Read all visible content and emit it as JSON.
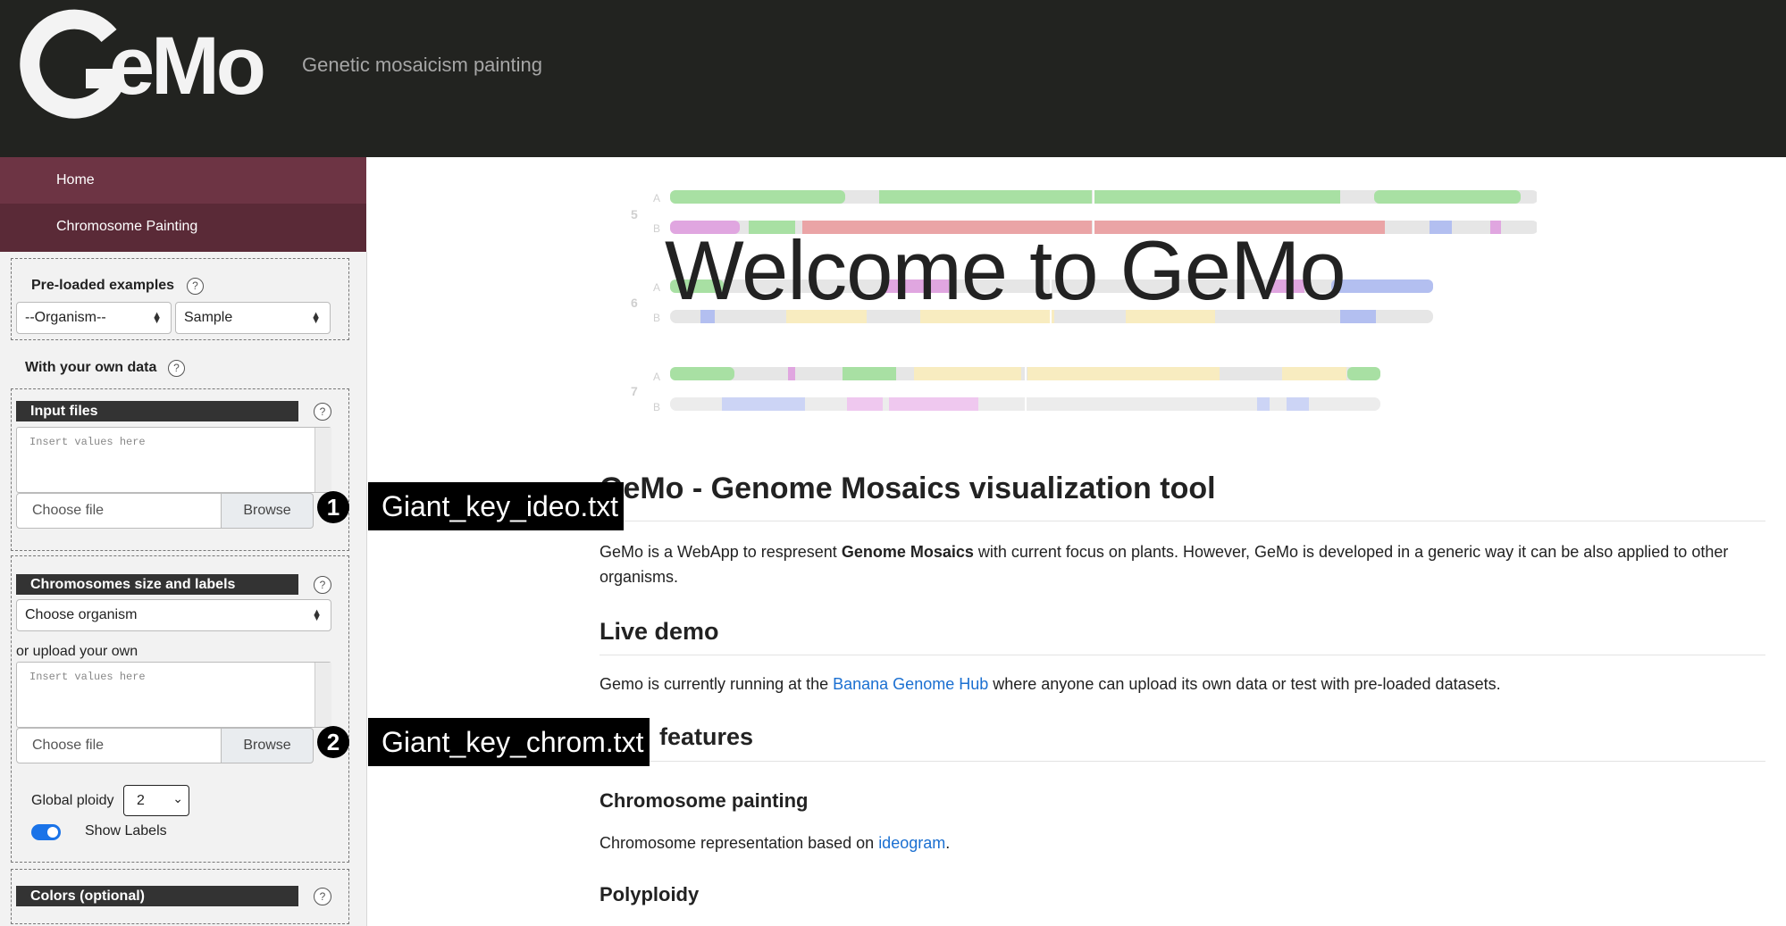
{
  "header": {
    "logo_text": "GeMo",
    "subtitle": "Genetic mosaicism painting"
  },
  "nav": {
    "home": "Home",
    "chromosome_painting": "Chromosome Painting"
  },
  "sidebar": {
    "preloaded": {
      "label": "Pre-loaded examples",
      "organism_select": "--Organism--",
      "sample_select": "Sample"
    },
    "own_data_label": "With your own data",
    "input_files": {
      "label": "Input files",
      "textarea_placeholder": "Insert values here",
      "file_placeholder": "Choose file",
      "browse": "Browse"
    },
    "chromosomes": {
      "label": "Chromosomes size and labels",
      "organism_select": "Choose organism",
      "upload_label": "or upload your own",
      "textarea_placeholder": "Insert values here",
      "file_placeholder": "Choose file",
      "browse": "Browse"
    },
    "ploidy": {
      "label": "Global ploidy",
      "value": "2"
    },
    "show_labels": {
      "label": "Show Labels",
      "on": true
    },
    "colors": {
      "label": "Colors (optional)"
    },
    "help_symbol": "?"
  },
  "annotations": [
    {
      "number": "1",
      "text": "Giant_key_ideo.txt"
    },
    {
      "number": "2",
      "text": "Giant_key_chrom.txt"
    }
  ],
  "ideogram": {
    "chromosomes": [
      {
        "number": "5",
        "tracks": [
          "A",
          "B"
        ]
      },
      {
        "number": "6",
        "tracks": [
          "A",
          "B"
        ]
      },
      {
        "number": "7",
        "tracks": [
          "A",
          "B"
        ]
      }
    ],
    "colors": {
      "green": "#a8e0a3",
      "red": "#eaa4a6",
      "pink": "#e0a6e0",
      "blue": "#b3bff0",
      "yellow": "#f8ecc0",
      "grey": "#e6e6e6"
    }
  },
  "main": {
    "welcome": "Welcome to GeMo",
    "title": "GeMo - Genome Mosaics visualization tool",
    "intro_pre": "GeMo is a WebApp to respresent ",
    "intro_bold": "Genome Mosaics",
    "intro_post": " with current focus on plants. However, GeMo is developed in a generic way it can be also applied to other organisms.",
    "live_demo_heading": "Live demo",
    "live_demo_pre": "Gemo is currently running at the ",
    "live_demo_link": "Banana Genome Hub",
    "live_demo_post": " where anyone can upload its own data or test with pre-loaded datasets.",
    "features_heading": "features",
    "chrom_painting_heading": "Chromosome painting",
    "chrom_painting_pre": "Chromosome representation based on ",
    "chrom_painting_link": "ideogram",
    "chrom_painting_post": ".",
    "polyploidy_heading": "Polyploidy"
  },
  "colors": {
    "header_bg": "#222320",
    "nav_home_bg": "#6d3444",
    "nav_paint_bg": "#5a2a37",
    "link": "#1a6fd1",
    "toggle": "#1a73e8"
  }
}
